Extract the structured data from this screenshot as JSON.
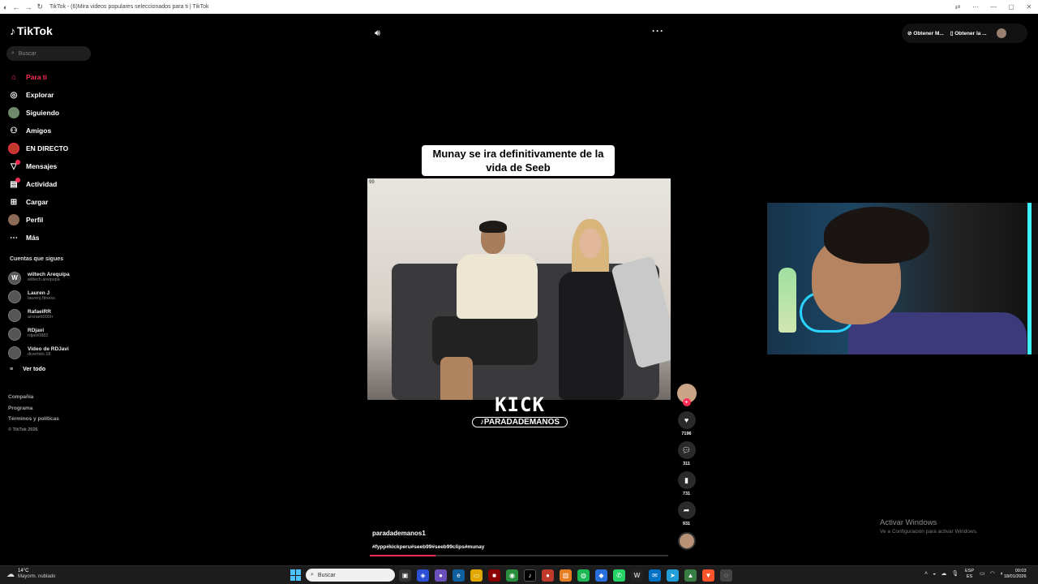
{
  "window": {
    "title": "TikTok - (6)Mira videos populares seleccionados para ti | TikTok",
    "controls": [
      "—",
      "▢",
      "✕"
    ]
  },
  "sidebar": {
    "logo": "TikTok",
    "search_placeholder": "Buscar",
    "menu": [
      {
        "label": "Para ti",
        "icon": "home-icon"
      },
      {
        "label": "Explorar",
        "icon": "compass-icon"
      },
      {
        "label": "Siguiendo",
        "icon": "following-avatar"
      },
      {
        "label": "Amigos",
        "icon": "friends-icon"
      },
      {
        "label": "EN DIRECTO",
        "icon": "live-avatar"
      },
      {
        "label": "Mensajes",
        "icon": "messages-icon"
      },
      {
        "label": "Actividad",
        "icon": "activity-icon"
      },
      {
        "label": "Cargar",
        "icon": "upload-icon"
      },
      {
        "label": "Perfil",
        "icon": "profile-avatar"
      },
      {
        "label": "Más",
        "icon": "more-icon"
      }
    ],
    "following_title": "Cuentas que sigues",
    "accounts": [
      {
        "name": "wiltech Arequipa",
        "handle": "wiltech.arequipa"
      },
      {
        "name": "Lauren J",
        "handle": "laurenj.fitness"
      },
      {
        "name": "RafaelRR",
        "handle": "aronarti000rr"
      },
      {
        "name": "RDjavi",
        "handle": "rdjavi0882"
      },
      {
        "name": "Video de RDJavi",
        "handle": "divertido.18"
      }
    ],
    "see_all": "Ver todo",
    "footer": [
      "Compañía",
      "Programa",
      "Términos y políticas"
    ],
    "copyright": "© TikTok 2026"
  },
  "header": {
    "get_app_1": "Obtener M...",
    "get_app_2": "Obtener la ..."
  },
  "video": {
    "caption": "Munay se ira definitivamente de la vida de Seeb",
    "corner_text": "99",
    "kick_text": "KICK",
    "kick_channel": "PARADADEMANOS",
    "username": "paradademanos1",
    "hashtags": "#fypp#kickperu#seeb99#seeb99clips#munay",
    "progress": 0.22,
    "likes": "7196",
    "comments": "311",
    "saves": "731",
    "shares": "931"
  },
  "watermark": {
    "line1": "Activar Windows",
    "line2": "Ve a Configuración para activar Windows."
  },
  "taskbar": {
    "temp": "14°C",
    "weather": "Mayorm. nublado",
    "search_placeholder": "Buscar",
    "lang1": "ESP",
    "lang2": "ES",
    "time": "00:03",
    "date": "18/01/2026"
  }
}
